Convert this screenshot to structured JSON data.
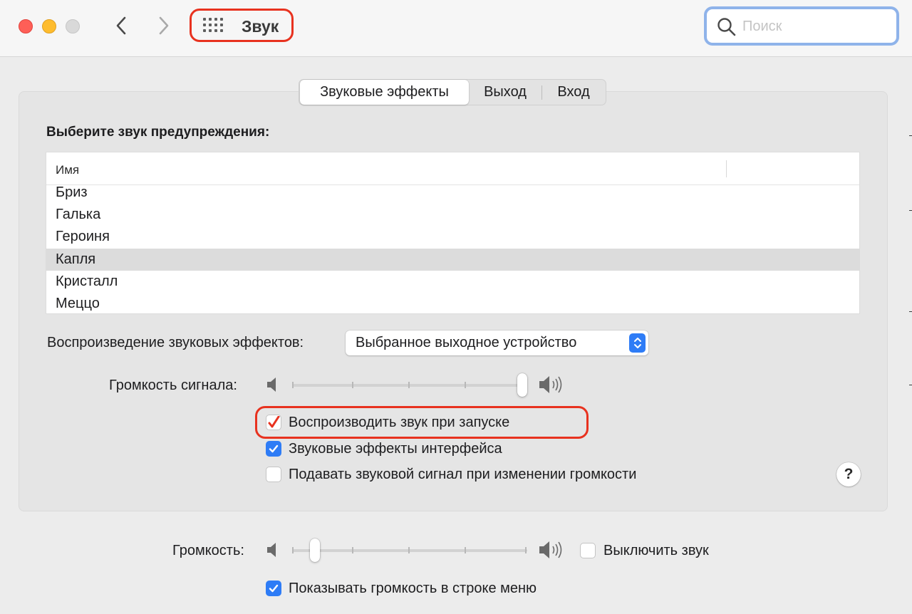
{
  "window": {
    "title": "Звук"
  },
  "search": {
    "placeholder": "Поиск",
    "value": ""
  },
  "tabs": [
    {
      "label": "Звуковые эффекты",
      "active": true
    },
    {
      "label": "Выход",
      "active": false
    },
    {
      "label": "Вход",
      "active": false
    }
  ],
  "sound_effects": {
    "alert_title": "Выберите звук предупреждения:",
    "list": {
      "header_name": "Имя",
      "items": [
        "Бриз",
        "Галька",
        "Героиня",
        "Капля",
        "Кристалл",
        "Меццо"
      ],
      "selected": "Капля"
    },
    "playback": {
      "label": "Воспроизведение звуковых эффектов:",
      "selected": "Выбранное выходное устройство"
    },
    "alert_volume": {
      "label": "Громкость сигнала:",
      "level": 1.0
    },
    "checkboxes": [
      {
        "label": "Воспроизводить звук при запуске",
        "checked": true
      },
      {
        "label": "Звуковые эффекты интерфейса",
        "checked": true
      },
      {
        "label": "Подавать звуковой сигнал при изменении громкости",
        "checked": false
      }
    ],
    "help_label": "?"
  },
  "output": {
    "volume_label": "Громкость:",
    "volume_level": 0.08,
    "mute_label": "Выключить звук",
    "mute_checked": false,
    "show_in_menu_label": "Показывать громкость в строке меню",
    "show_in_menu_checked": true
  },
  "colors": {
    "accent": "#2e7cf6",
    "annotation_red": "#e8321f",
    "close": "#fe5f57",
    "minimize": "#febc2e",
    "zoom_disabled": "#d9d9d9"
  },
  "icons": {
    "back": "chevron-left-icon",
    "forward": "chevron-right-icon",
    "grid": "grid-icon",
    "search": "search-icon",
    "speaker_low": "speaker-low-icon",
    "speaker_high": "speaker-high-icon",
    "checkmark": "checkmark-icon",
    "popup": "updown-arrows-icon"
  }
}
